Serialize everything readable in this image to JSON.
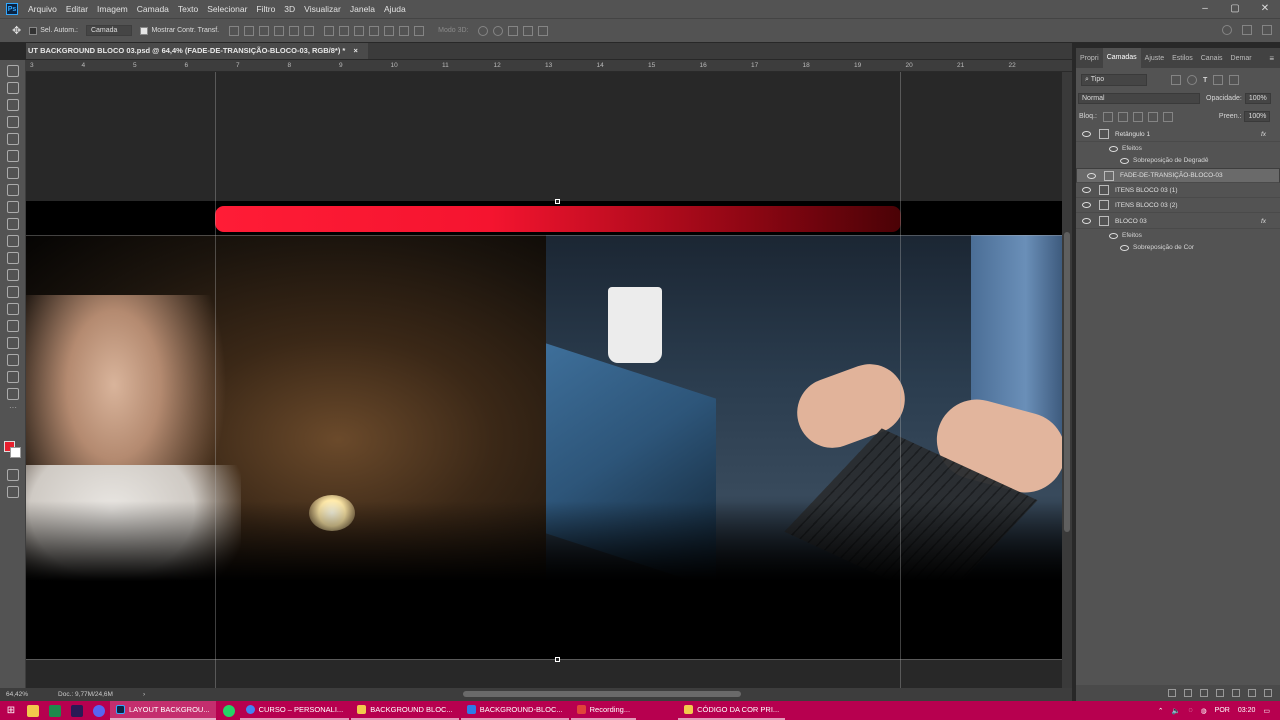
{
  "app": {
    "logo": "Ps"
  },
  "menu": [
    "Arquivo",
    "Editar",
    "Imagem",
    "Camada",
    "Texto",
    "Selecionar",
    "Filtro",
    "3D",
    "Visualizar",
    "Janela",
    "Ajuda"
  ],
  "options": {
    "auto_select_label": "Sel. Autom.:",
    "auto_select_value": "Camada",
    "show_transform_label": "Mostrar Contr. Transf.",
    "mode3d_label": "Modo 3D:"
  },
  "document_tab": {
    "title": "UT BACKGROUND BLOCO 03.psd @ 64,4% (FADE-DE-TRANSIÇÃO-BLOCO-03, RGB/8*) *",
    "close": "×"
  },
  "ruler": {
    "ticks": [
      "3",
      "4",
      "5",
      "6",
      "7",
      "8",
      "9",
      "10",
      "11",
      "12",
      "13",
      "14",
      "15",
      "16",
      "17",
      "18",
      "19",
      "20",
      "21",
      "22"
    ]
  },
  "status": {
    "zoom": "64,42%",
    "doc": "Doc.: 9,77M/24,6M",
    "arrow": "›"
  },
  "layers_panel": {
    "tabs": [
      "Propri",
      "Camadas",
      "Ajuste",
      "Estilos",
      "Canais",
      "Demar"
    ],
    "active_tab": "Camadas",
    "filter": "Tipo",
    "blend_mode": "Normal",
    "opacity_label": "Opacidade:",
    "opacity_value": "100%",
    "lock_label": "Bloq.:",
    "fill_label": "Preen.:",
    "fill_value": "100%",
    "fx_label": "fx",
    "layers": [
      {
        "name": "Retângulo 1",
        "effects_label": "Efeitos",
        "effect": "Sobreposição de Degradê"
      },
      {
        "name": "FADE-DE-TRANSIÇÃO-BLOCO-03"
      },
      {
        "name": "ITENS BLOCO 03 (1)"
      },
      {
        "name": "ITENS BLOCO 03 (2)"
      },
      {
        "name": "BLOCO 03",
        "effects_label": "Efeitos",
        "effect": "Sobreposição de Cor"
      }
    ]
  },
  "taskbar": {
    "apps": [
      {
        "label": "LAYOUT BACKGROU...",
        "color": "#31a8ff"
      },
      {
        "label": "CURSO – PERSONALI...",
        "color": "#4285f4"
      },
      {
        "label": "BACKGROUND BLOC...",
        "color": "#f2c94c"
      },
      {
        "label": "BACKGROUND-BLOC...",
        "color": "#2d7be8"
      },
      {
        "label": "Recording...",
        "color": "#e0453a"
      },
      {
        "label": "CÓDIGO DA COR PRI...",
        "color": "#f2c94c"
      }
    ],
    "lang": "POR",
    "time": "03:20"
  },
  "colors": {
    "foreground": "#e8202e",
    "background": "#ffffff",
    "accent_bar_start": "#ff1c36",
    "taskbar": "#b7004f"
  }
}
